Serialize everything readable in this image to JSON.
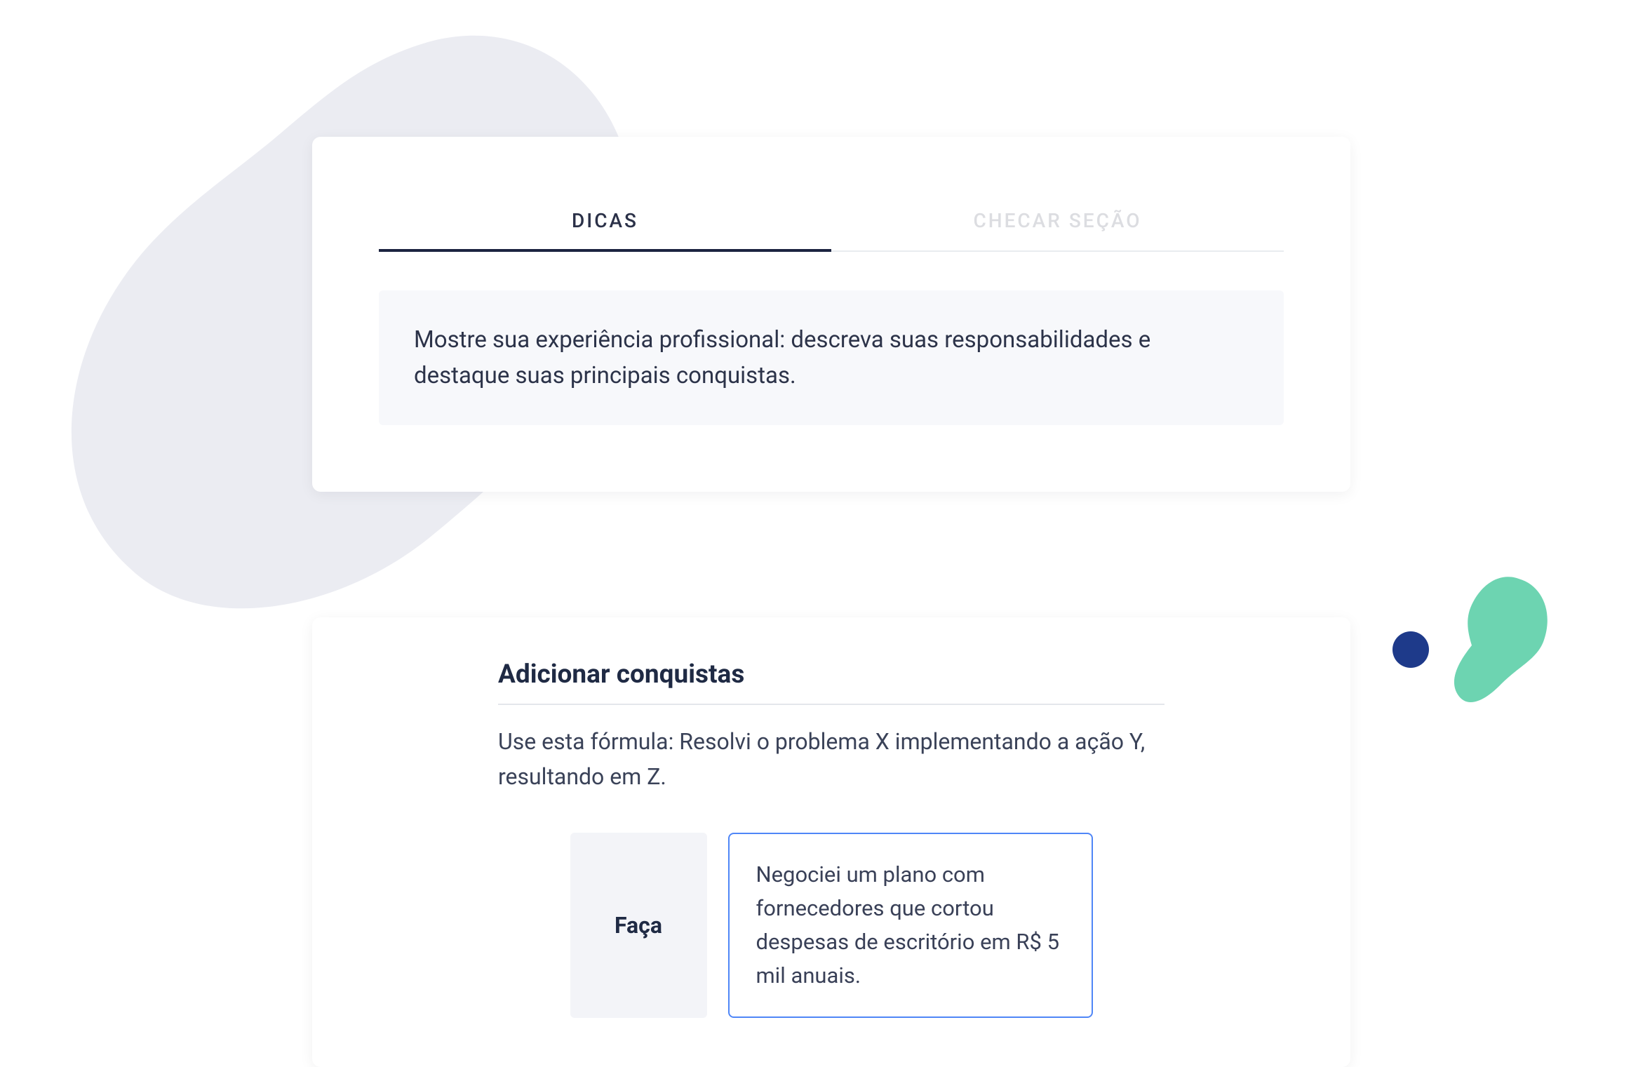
{
  "tabs": {
    "tips": "DICAS",
    "check": "CHECAR SEÇÃO"
  },
  "tip": {
    "body": "Mostre sua experiência profissional: descreva suas responsabilidades e destaque suas principais conquistas."
  },
  "section": {
    "title": "Adicionar conquistas",
    "description": "Use esta fórmula: Resolvi o problema X implementando a ação Y, resultando em Z.",
    "do_label": "Faça",
    "do_example": "Negociei um plano com fornecedores que cortou despesas de escritório em R$ 5 mil anuais."
  }
}
